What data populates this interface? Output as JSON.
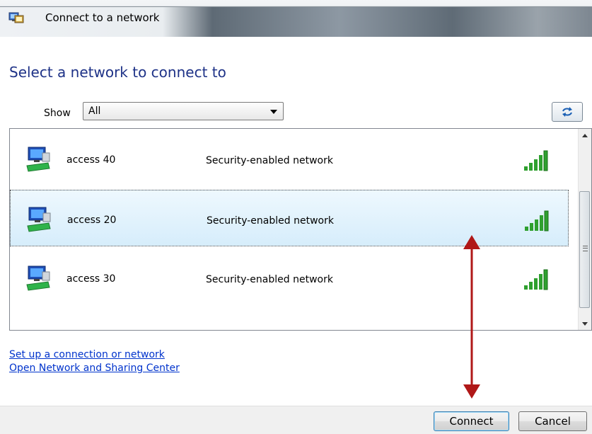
{
  "window": {
    "title": "Connect to a network"
  },
  "main": {
    "heading": "Select a network to connect to",
    "filter": {
      "label": "Show",
      "selected": "All"
    }
  },
  "networks": [
    {
      "name": "access 40",
      "security": "Security-enabled network",
      "signal_bars": 5,
      "selected": false
    },
    {
      "name": "access 20",
      "security": "Security-enabled network",
      "signal_bars": 5,
      "selected": true
    },
    {
      "name": "access 30",
      "security": "Security-enabled network",
      "signal_bars": 5,
      "selected": false
    }
  ],
  "links": [
    "Set up a connection or network",
    "Open Network and Sharing Center"
  ],
  "buttons": {
    "connect": "Connect",
    "cancel": "Cancel"
  },
  "icons": {
    "window": "network-connect-icon",
    "refresh": "refresh-icon",
    "network": "wireless-network-icon",
    "signal": "signal-strength-icon"
  },
  "colors": {
    "heading": "#1e3287",
    "link": "#0033cc",
    "selection": "#d6edfb",
    "signal": "#2fa02f",
    "annotation_arrow": "#b01818"
  }
}
